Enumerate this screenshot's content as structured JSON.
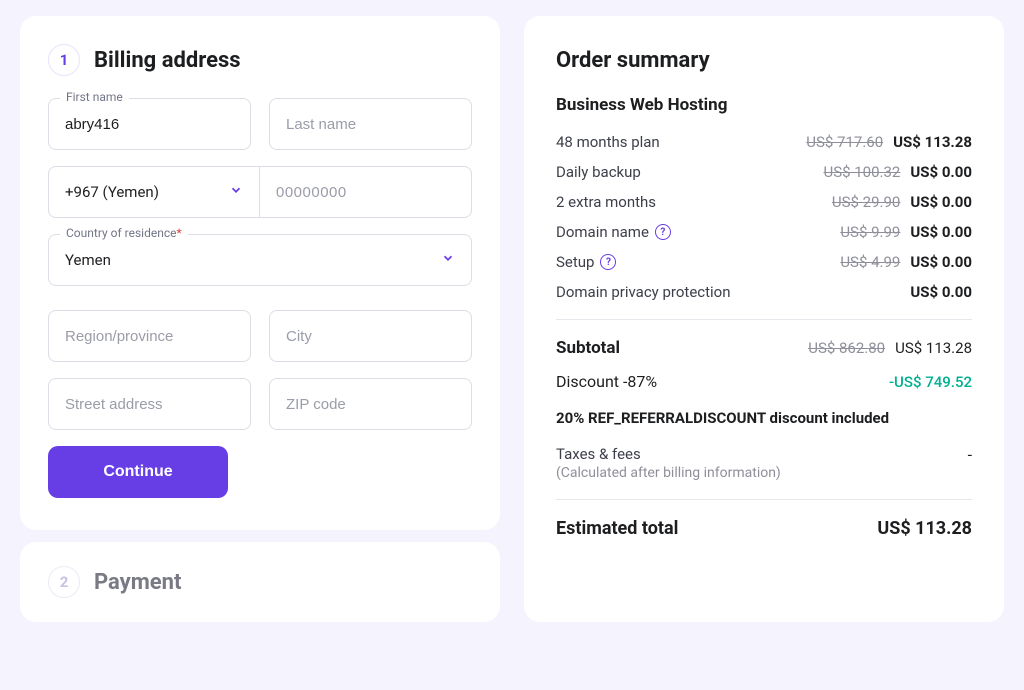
{
  "billing": {
    "step_number": "1",
    "title": "Billing address",
    "first_name_label": "First name",
    "first_name_value": "abry416",
    "last_name_placeholder": "Last name",
    "phone_code": "+967 (Yemen)",
    "phone_placeholder": "00000000",
    "country_label": "Country of residence",
    "country_required": "*",
    "country_value": "Yemen",
    "region_placeholder": "Region/province",
    "city_placeholder": "City",
    "street_placeholder": "Street address",
    "zip_placeholder": "ZIP code",
    "continue_label": "Continue"
  },
  "payment": {
    "step_number": "2",
    "title": "Payment"
  },
  "summary": {
    "title": "Order summary",
    "product": "Business Web Hosting",
    "lines": [
      {
        "label": "48 months plan",
        "strike": "US$ 717.60",
        "price": "US$ 113.28",
        "help": false
      },
      {
        "label": "Daily backup",
        "strike": "US$ 100.32",
        "price": "US$ 0.00",
        "help": false
      },
      {
        "label": "2 extra months",
        "strike": "US$ 29.90",
        "price": "US$ 0.00",
        "help": false
      },
      {
        "label": "Domain name",
        "strike": "US$ 9.99",
        "price": "US$ 0.00",
        "help": true
      },
      {
        "label": "Setup",
        "strike": "US$ 4.99",
        "price": "US$ 0.00",
        "help": true
      },
      {
        "label": "Domain privacy protection",
        "strike": "",
        "price": "US$ 0.00",
        "help": false
      }
    ],
    "subtotal_label": "Subtotal",
    "subtotal_strike": "US$ 862.80",
    "subtotal_price": "US$ 113.28",
    "discount_label": "Discount -87%",
    "discount_amount": "-US$ 749.52",
    "discount_note": "20% REF_REFERRALDISCOUNT discount included",
    "tax_label": "Taxes & fees",
    "tax_dash": "-",
    "tax_note": "(Calculated after billing information)",
    "total_label": "Estimated total",
    "total_price": "US$ 113.28"
  }
}
